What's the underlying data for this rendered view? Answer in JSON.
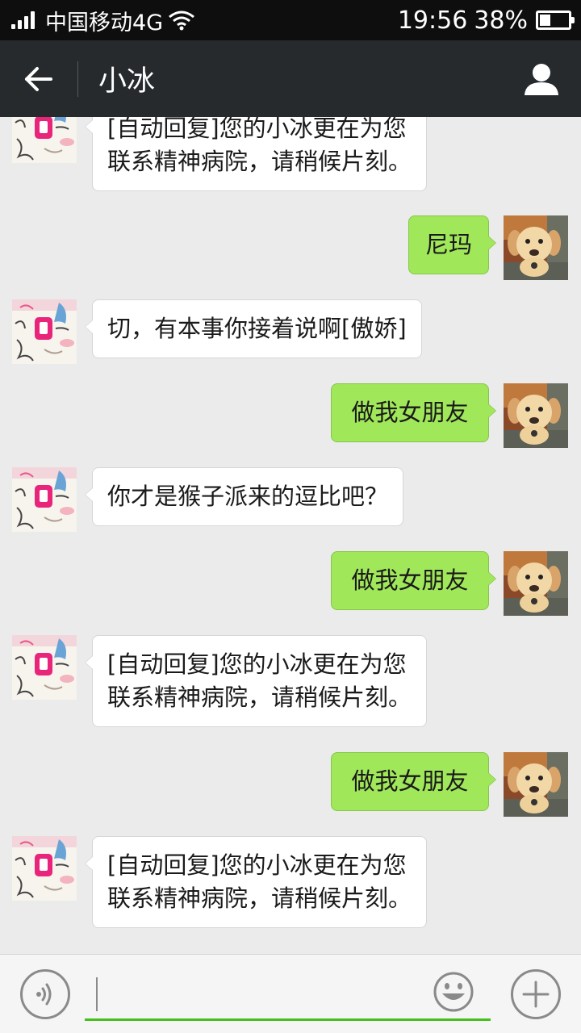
{
  "status_bar": {
    "carrier": "中国移动4G",
    "time": "19:56",
    "battery": "38%",
    "battery_level": 0.38
  },
  "header": {
    "title": "小冰",
    "back_icon": "arrow-left-icon",
    "profile_icon": "person-icon"
  },
  "messages": [
    {
      "from": "xiaobing",
      "lines": [
        "[自动回复]您的小冰更在为您",
        "联系精神病院，请稍候片刻。"
      ]
    },
    {
      "from": "me",
      "lines": [
        "尼玛"
      ]
    },
    {
      "from": "xiaobing",
      "lines": [
        "切，有本事你接着说啊[傲娇]"
      ]
    },
    {
      "from": "me",
      "lines": [
        "做我女朋友"
      ]
    },
    {
      "from": "xiaobing",
      "lines": [
        "你才是猴子派来的逗比吧？"
      ]
    },
    {
      "from": "me",
      "lines": [
        "做我女朋友"
      ]
    },
    {
      "from": "xiaobing",
      "lines": [
        "[自动回复]您的小冰更在为您",
        "联系精神病院，请稍候片刻。"
      ]
    },
    {
      "from": "me",
      "lines": [
        "做我女朋友"
      ]
    },
    {
      "from": "xiaobing",
      "lines": [
        "[自动回复]您的小冰更在为您",
        "联系精神病院，请稍候片刻。"
      ]
    }
  ],
  "input_bar": {
    "text": "",
    "voice_icon": "voice-icon",
    "emoji_icon": "smiley-icon",
    "plus_icon": "plus-icon"
  },
  "colors": {
    "status_bg": "#0e0e0e",
    "header_bg": "#262a2d",
    "chat_bg": "#ebebeb",
    "outgoing_bubble": "#a0e75a",
    "incoming_bubble": "#ffffff",
    "input_underline": "#45c01a"
  }
}
